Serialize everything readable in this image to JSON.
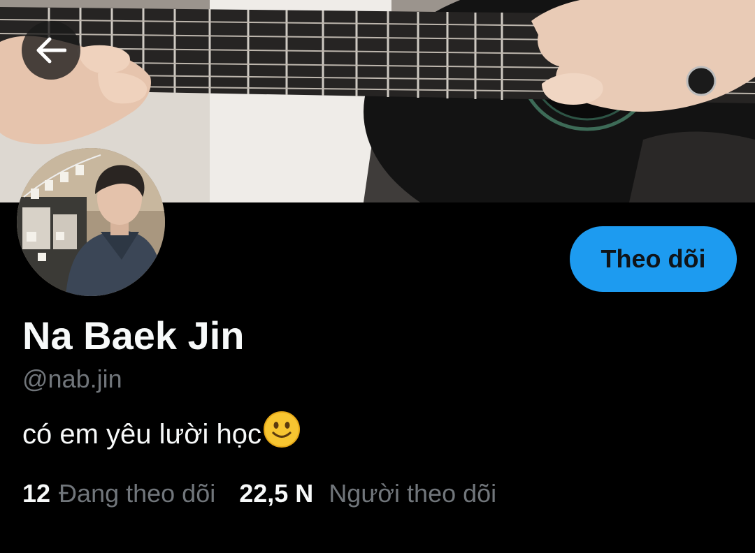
{
  "profile": {
    "display_name": "Na Baek Jin",
    "handle": "@nab.jin",
    "bio": "có em yêu lười học",
    "bio_emoji": "slightly-smiling-face-icon",
    "avatar": "profile-photo",
    "banner": "guitar-banner-photo"
  },
  "actions": {
    "back_icon": "arrow-left-icon",
    "follow_label": "Theo dõi"
  },
  "stats": {
    "following_count": "12",
    "following_label": "Đang theo dõi",
    "followers_count": "22,5 N",
    "followers_label": "Người theo dõi"
  },
  "colors": {
    "background": "#000000",
    "accent": "#1d9bf0",
    "text_primary": "#f7f9f9",
    "text_secondary": "#71767b"
  }
}
